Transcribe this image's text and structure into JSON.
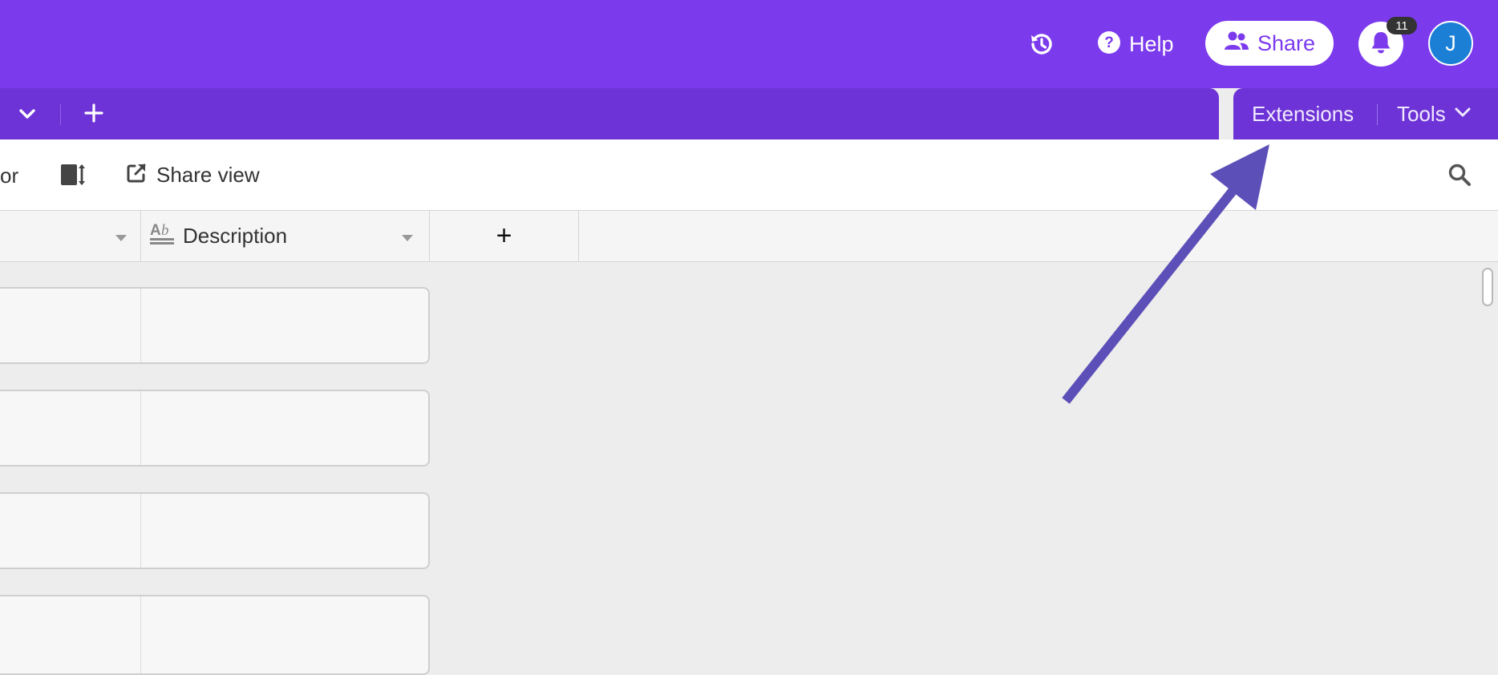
{
  "header": {
    "help_label": "Help",
    "share_label": "Share",
    "notification_count": "11",
    "avatar_initial": "J",
    "brand_color": "#7c3aed"
  },
  "tabbar": {
    "extensions_label": "Extensions",
    "tools_label": "Tools"
  },
  "toolbar": {
    "partial_label": "or",
    "share_view_label": "Share view"
  },
  "grid": {
    "field_name": "Description",
    "add_field_symbol": "+",
    "records": [
      {
        "description": ""
      },
      {
        "description": ""
      },
      {
        "description": ""
      },
      {
        "description": ""
      }
    ]
  },
  "icons": {
    "history": "history-icon",
    "help": "help-circle-icon",
    "share": "users-icon",
    "bell": "bell-icon",
    "row_height": "row-height-icon",
    "share_view": "external-link-icon",
    "search": "search-icon",
    "field_type": "text-field-icon"
  }
}
